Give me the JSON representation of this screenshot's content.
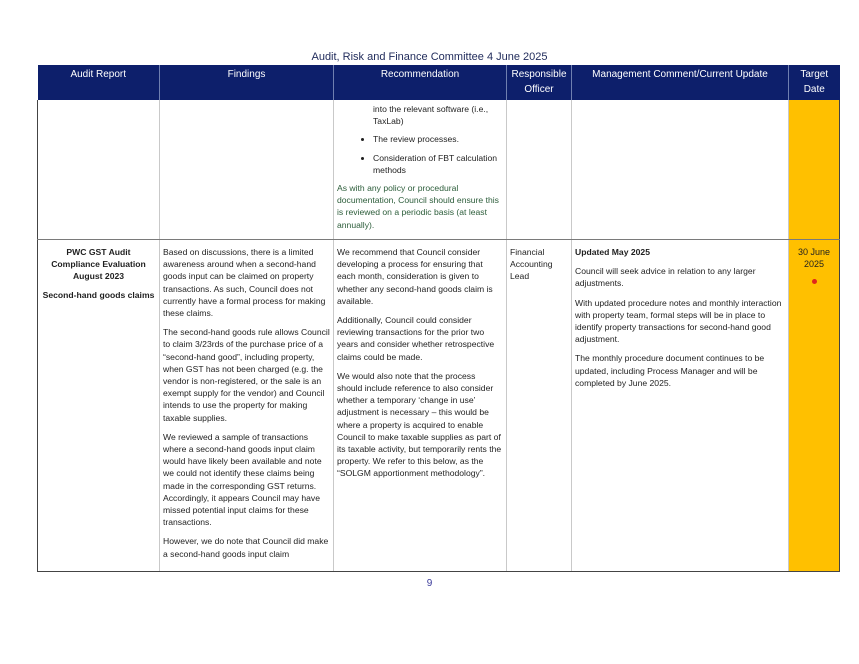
{
  "document": {
    "title": "Audit, Risk and Finance Committee 4 June 2025",
    "page_number": "9"
  },
  "table": {
    "headers": {
      "audit_report": "Audit Report",
      "findings": "Findings",
      "recommendation": "Recommendation",
      "responsible_officer_line1": "Responsible",
      "responsible_officer_line2": "Officer",
      "management_comment": "Management Comment/Current Update",
      "target_date_line1": "Target",
      "target_date_line2": "Date"
    },
    "continued_row": {
      "recommendation_items": [
        "into the relevant software (i.e., TaxLab)",
        "The review processes.",
        "Consideration of FBT calculation methods"
      ],
      "recommendation_note": "As with any policy or procedural documentation, Council should ensure this is reviewed on a periodic basis (at least annually)."
    },
    "row": {
      "audit_report_title": "PWC GST Audit Compliance Evaluation August 2023",
      "audit_report_subtitle": "Second-hand goods claims",
      "findings": [
        "Based on discussions, there is a limited awareness around when a second-hand goods input can be claimed on property transactions. As such, Council does not currently have a formal process for making these claims.",
        "The second-hand goods rule allows Council to claim 3/23rds of the purchase price of a “second-hand good”, including property, when GST has not been charged (e.g. the vendor is non-registered, or the sale is an exempt supply for the vendor) and Council intends to use the property for making taxable supplies.",
        "We reviewed a sample of transactions where a second-hand goods input claim would have likely been available and note we could not identify these claims being made in the corresponding GST returns. Accordingly, it appears Council may have missed potential input claims for these transactions.",
        "However, we do note that Council did make a second-hand goods input claim"
      ],
      "recommendation": [
        "We recommend that Council consider developing a process for ensuring that each month, consideration is given to whether any second-hand goods claim is available.",
        "Additionally, Council could consider reviewing transactions for the prior two years and consider whether retrospective claims could be made.",
        "We would also note that the process should include reference to also consider whether a temporary ‘change in use’ adjustment is necessary – this would be where a property is acquired to enable Council to make taxable supplies as part of its taxable activity, but temporarily rents the property. We refer to this below, as the “SOLGM apportionment methodology”."
      ],
      "responsible_officer": "Financial Accounting Lead",
      "management_heading": "Updated May 2025",
      "management_comments": [
        "Council will seek advice in relation to any larger adjustments.",
        "With updated procedure notes and monthly interaction with property team, formal steps will be in place to identify property transactions for second-hand good adjustment.",
        "The monthly procedure document continues to be updated, including Process Manager and will be completed by June 2025."
      ],
      "target_date": "30 June 2025",
      "status_color": "#e0261c"
    }
  },
  "colors": {
    "header_bg": "#0d1f6b",
    "target_col_bg": "#ffc000",
    "note_text": "#2c5d3a"
  }
}
